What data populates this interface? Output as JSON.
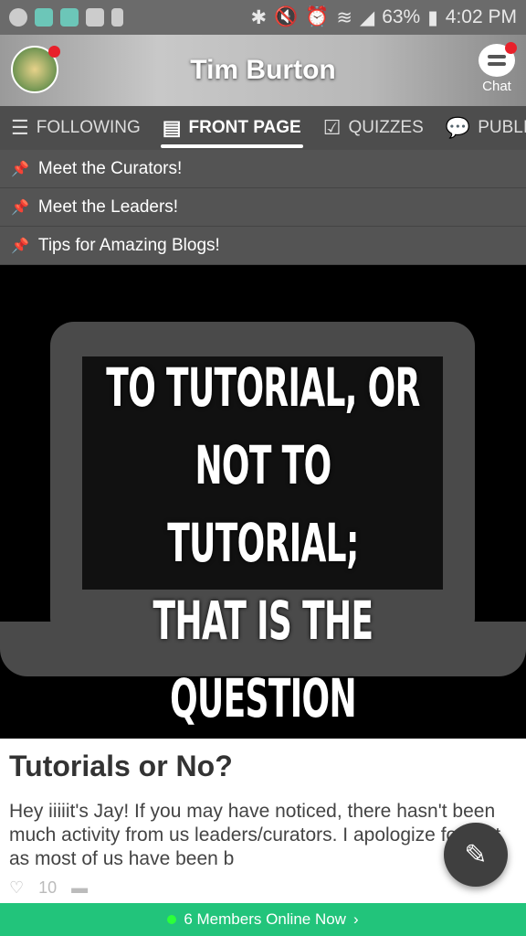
{
  "status_bar": {
    "battery": "63%",
    "time": "4:02 PM"
  },
  "header": {
    "title": "Tim Burton",
    "chat_label": "Chat"
  },
  "tabs": [
    {
      "label": "FOLLOWING",
      "icon": "list-arrow-icon"
    },
    {
      "label": "FRONT PAGE",
      "icon": "document-icon",
      "active": true
    },
    {
      "label": "QUIZZES",
      "icon": "checkbox-icon"
    },
    {
      "label": "PUBLIC",
      "icon": "chat-bubbles-icon"
    }
  ],
  "pinned": [
    "Meet the Curators!",
    "Meet the Leaders!",
    "Tips for Amazing Blogs!"
  ],
  "hero": {
    "line1": "TO TUTORIAL, OR",
    "line2": "NOT TO TUTORIAL;",
    "line3": "THAT IS THE",
    "line4": "QUESTION"
  },
  "post": {
    "title": "Tutorials or No?",
    "excerpt": "Hey iiiiit's Jay! If you may have noticed, there hasn't been much activity from us leaders/curators. I apologize for that as most of us have been b",
    "likes": "10"
  },
  "online_bar": {
    "label": "6 Members Online Now",
    "color": "#22c47b"
  }
}
